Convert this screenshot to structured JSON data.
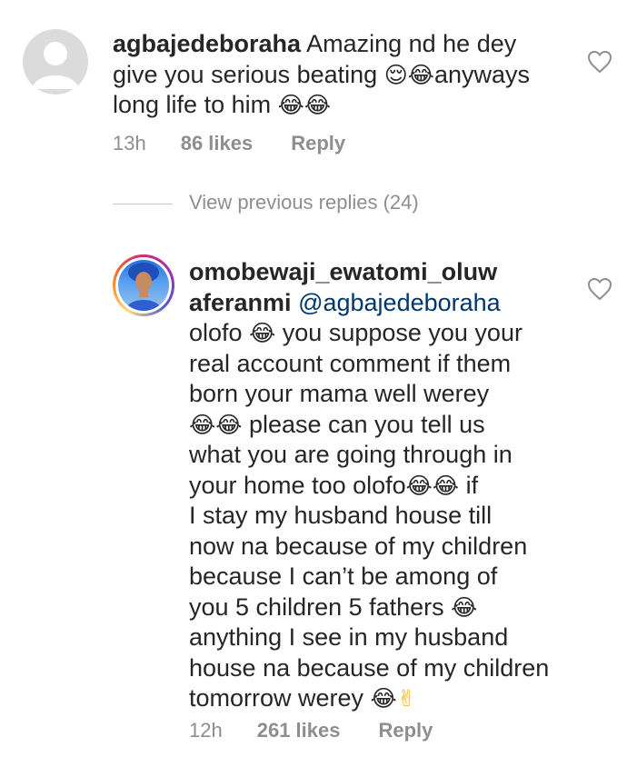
{
  "comment": {
    "username": "agbajedeboraha",
    "text_line1": " Amazing nd he dey",
    "text_line2a": "give you serious beating ",
    "emoji_relieved": "😌",
    "emoji_laugh": "😂",
    "text_line2b": "anyways",
    "text_line3": "long life to him ",
    "time": "13h",
    "likes": "86 likes",
    "reply_label": "Reply"
  },
  "view_previous_replies": "View previous replies (24)",
  "reply": {
    "username_part1": "omobewaji_ewatomi_oluw",
    "username_part2": "aferanmi",
    "mention": "@agbajedeboraha",
    "l1": "olofo ",
    "l1b": " you suppose you your",
    "l2": "real account comment if them",
    "l3": "born your mama well werey",
    "l4b": " please can you tell us",
    "l5": "what you are going through in",
    "l6a": "your home too olofo",
    "l6b": " if",
    "l7": "I stay my husband house till",
    "l8": "now na because of my children",
    "l9": "because I can’t be among of",
    "l10": "you 5 children 5 fathers ",
    "l11": "anything I see in my husband",
    "l12": "house na because of my children",
    "l13": "tomorrow werey ",
    "emoji_peace": "✌",
    "time": "12h",
    "likes": "261 likes",
    "reply_label": "Reply"
  },
  "colors": {
    "text": "#262626",
    "secondary": "#8e8e8e",
    "mention": "#00376b"
  },
  "icons": [
    "default-avatar-icon",
    "heart-icon",
    "laughing-emoji",
    "relieved-emoji",
    "peace-hand-emoji"
  ]
}
